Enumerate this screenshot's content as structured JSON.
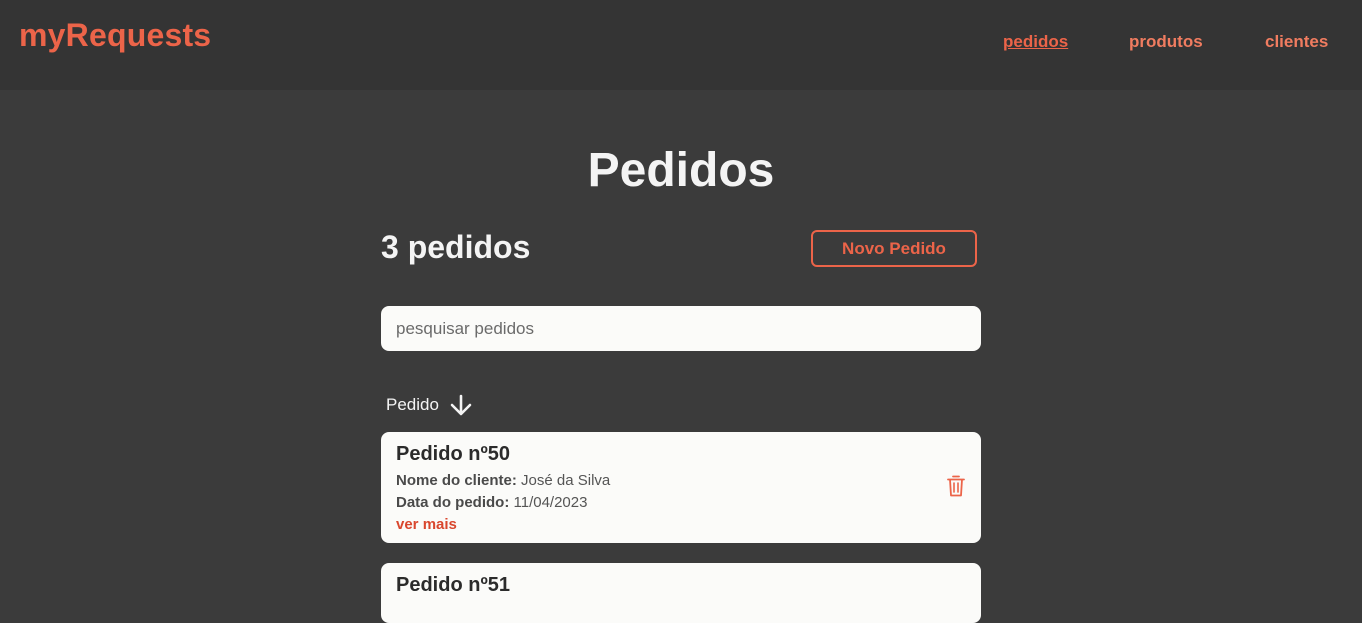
{
  "header": {
    "brand": "myRequests",
    "nav": [
      {
        "label": "pedidos",
        "active": true
      },
      {
        "label": "produtos",
        "active": false
      },
      {
        "label": "clientes",
        "active": false
      }
    ]
  },
  "main": {
    "title": "Pedidos",
    "count_label": "3 pedidos",
    "new_button_label": "Novo Pedido",
    "search": {
      "placeholder": "pesquisar pedidos",
      "value": ""
    },
    "sort": {
      "label": "Pedido",
      "icon": "arrow-down-icon"
    },
    "orders": [
      {
        "title": "Pedido nº50",
        "client_label": "Nome do cliente:",
        "client_value": "José da Silva",
        "date_label": "Data do pedido:",
        "date_value": "11/04/2023",
        "more_label": "ver mais",
        "delete_icon": "trash-icon"
      },
      {
        "title": "Pedido nº51"
      }
    ]
  },
  "colors": {
    "accent": "#ec6449",
    "background": "#3b3b3b",
    "header_background": "#343434",
    "card_background": "#fbfbf9"
  }
}
